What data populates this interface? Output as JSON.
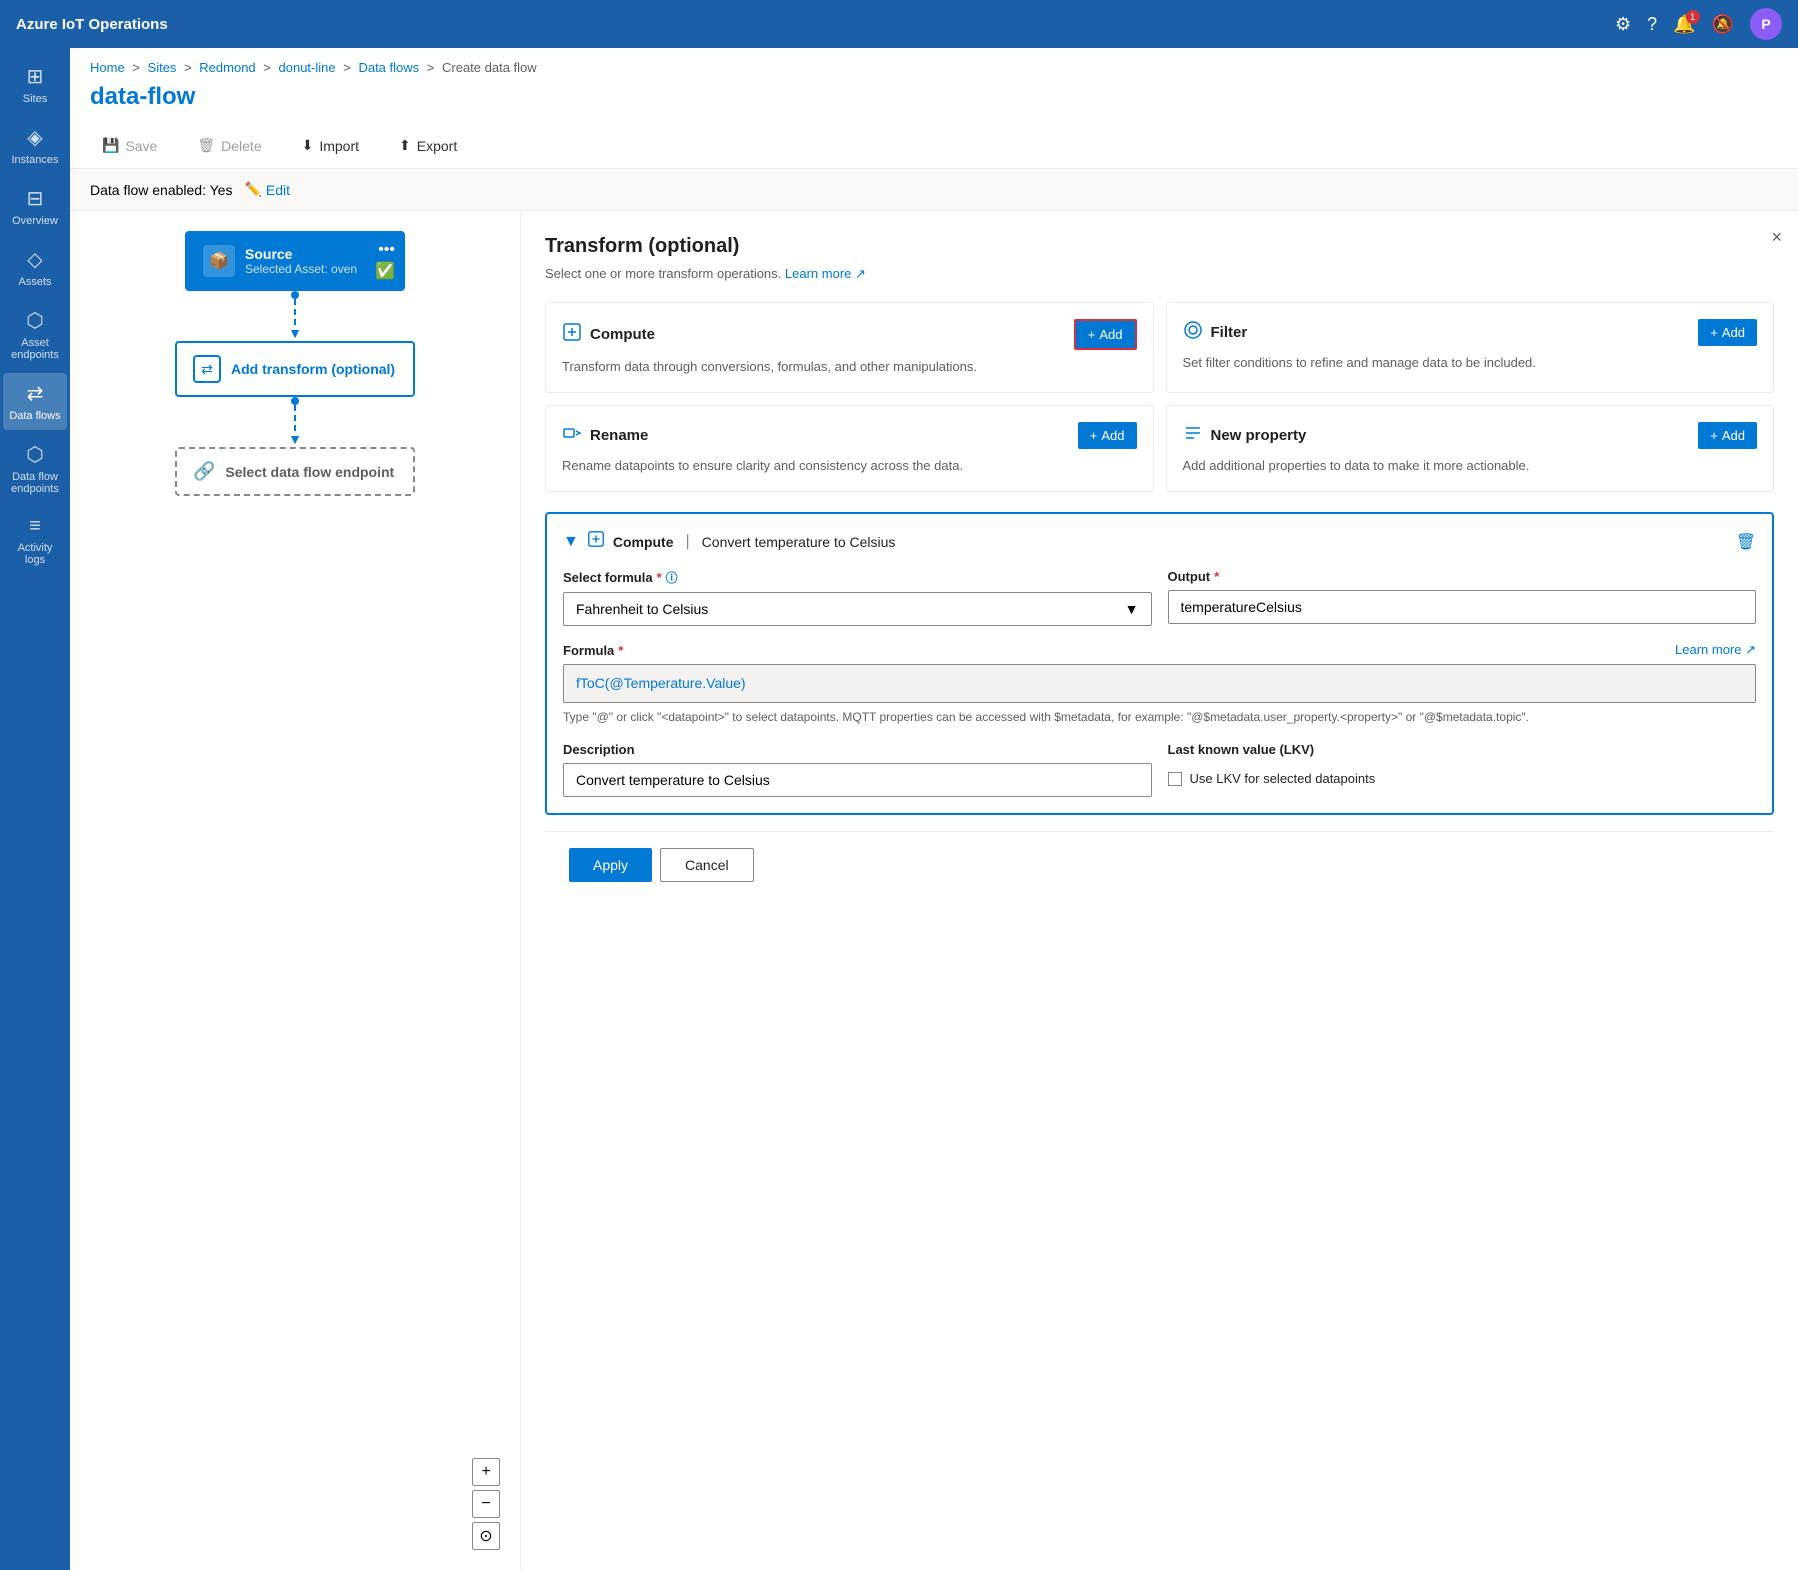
{
  "app": {
    "title": "Azure IoT Operations",
    "avatar_letter": "P"
  },
  "breadcrumb": {
    "items": [
      "Home",
      "Sites",
      "Redmond",
      "donut-line",
      "Data flows",
      "Create data flow"
    ]
  },
  "page": {
    "title": "data-flow"
  },
  "toolbar": {
    "save_label": "Save",
    "delete_label": "Delete",
    "import_label": "Import",
    "export_label": "Export"
  },
  "flow_enabled": {
    "label": "Data flow enabled: Yes",
    "edit_label": "Edit"
  },
  "sidebar": {
    "items": [
      {
        "id": "sites",
        "label": "Sites",
        "icon": "⊞"
      },
      {
        "id": "instances",
        "label": "Instances",
        "icon": "◈"
      },
      {
        "id": "overview",
        "label": "Overview",
        "icon": "⊟"
      },
      {
        "id": "assets",
        "label": "Assets",
        "icon": "◇"
      },
      {
        "id": "asset-endpoints",
        "label": "Asset endpoints",
        "icon": "⬡"
      },
      {
        "id": "data-flows",
        "label": "Data flows",
        "icon": "⇄"
      },
      {
        "id": "data-flow-endpoints",
        "label": "Data flow endpoints",
        "icon": "⬡"
      },
      {
        "id": "activity-logs",
        "label": "Activity logs",
        "icon": "≡"
      }
    ]
  },
  "flow_nodes": {
    "source": {
      "label": "Source",
      "sublabel": "Selected Asset: oven"
    },
    "transform": {
      "label": "Add transform (optional)"
    },
    "endpoint": {
      "label": "Select data flow endpoint"
    }
  },
  "panel": {
    "title": "Transform (optional)",
    "subtitle": "Select one or more transform operations.",
    "learn_more": "Learn more",
    "close_label": "×",
    "cards": [
      {
        "id": "compute",
        "icon": "⊞",
        "title": "Compute",
        "desc": "Transform data through conversions, formulas, and other manipulations.",
        "add_label": "+ Add"
      },
      {
        "id": "filter",
        "icon": "⊜",
        "title": "Filter",
        "desc": "Set filter conditions to refine and manage data to be included.",
        "add_label": "+ Add"
      },
      {
        "id": "rename",
        "icon": "⊞",
        "title": "Rename",
        "desc": "Rename datapoints to ensure clarity and consistency across the data.",
        "add_label": "+ Add"
      },
      {
        "id": "new-property",
        "icon": "≡",
        "title": "New property",
        "desc": "Add additional properties to data to make it more actionable.",
        "add_label": "+ Add"
      }
    ],
    "compute_expanded": {
      "title": "Compute",
      "subtitle": "Convert temperature to Celsius",
      "formula_label": "Select formula",
      "formula_required": "*",
      "formula_value": "Fahrenheit to Celsius",
      "output_label": "Output",
      "output_required": "*",
      "output_value": "temperatureCelsius",
      "formula_section_label": "Formula",
      "formula_required2": "*",
      "learn_more": "Learn more",
      "formula_code": "fToC(@Temperature.Value)",
      "formula_hint": "Type \"@\" or click \"<datapoint>\" to select datapoints. MQTT properties can be accessed with $metadata, for example: \"@$metadata.user_property.<property>\" or \"@$metadata.topic\".",
      "description_label": "Description",
      "description_value": "Convert temperature to Celsius",
      "lkv_label": "Last known value (LKV)",
      "lkv_checkbox_label": "Use LKV for selected datapoints"
    }
  },
  "footer": {
    "apply_label": "Apply",
    "cancel_label": "Cancel"
  },
  "notifications": {
    "count": "1"
  }
}
